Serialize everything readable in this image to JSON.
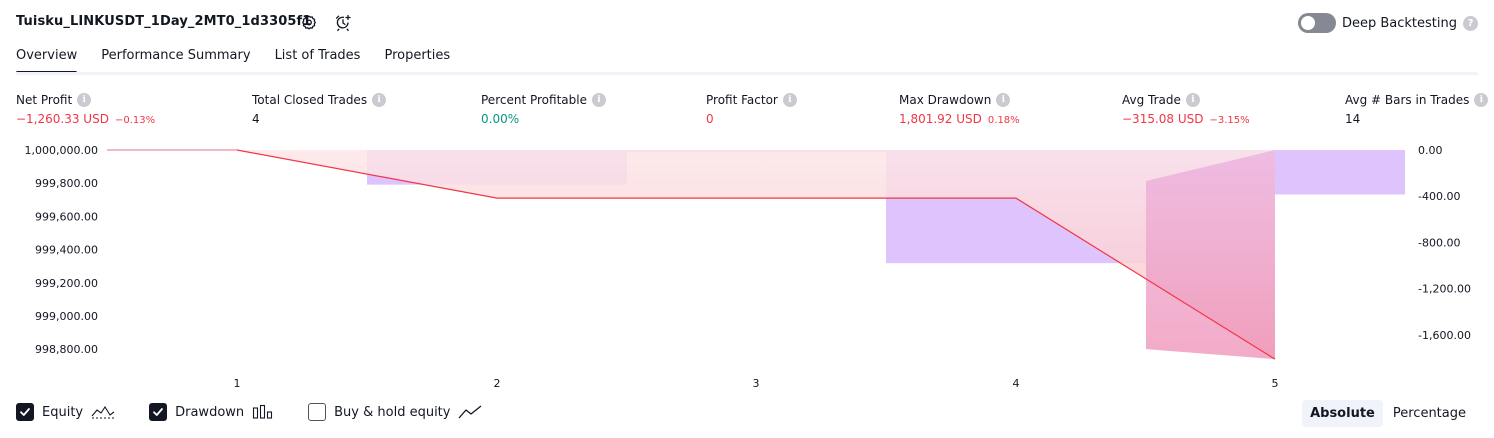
{
  "header": {
    "strategy_title": "Tuisku_LINKUSDT_1Day_2MT0_1d3305f1",
    "settings_icon": "gear-icon",
    "alert_icon": "alarm-clock-plus-icon",
    "deep_backtesting_label": "Deep Backtesting",
    "deep_backtesting_enabled": false,
    "help_icon": "question-icon"
  },
  "tabs": [
    {
      "label": "Overview",
      "active": true
    },
    {
      "label": "Performance Summary",
      "active": false
    },
    {
      "label": "List of Trades",
      "active": false
    },
    {
      "label": "Properties",
      "active": false
    }
  ],
  "metrics": {
    "net_profit": {
      "label": "Net Profit",
      "value": "−1,260.33 USD",
      "sub": "−0.13%"
    },
    "total_closed_trades": {
      "label": "Total Closed Trades",
      "value": "4"
    },
    "percent_profitable": {
      "label": "Percent Profitable",
      "value": "0.00%"
    },
    "profit_factor": {
      "label": "Profit Factor",
      "value": "0"
    },
    "max_drawdown": {
      "label": "Max Drawdown",
      "value": "1,801.92 USD",
      "sub": "0.18%"
    },
    "avg_trade": {
      "label": "Avg Trade",
      "value": "−315.08 USD",
      "sub": "−3.15%"
    },
    "avg_bars": {
      "label": "Avg # Bars in Trades",
      "value": "14"
    }
  },
  "chart_data": {
    "type": "line",
    "x_tick_labels": [
      "1",
      "2",
      "3",
      "4",
      "5"
    ],
    "left_axis": {
      "tick_labels": [
        "1,000,000.00",
        "999,800.00",
        "999,600.00",
        "999,400.00",
        "999,200.00",
        "999,000.00",
        "998,800.00"
      ],
      "ticks": [
        1000000,
        999800,
        999600,
        999400,
        999200,
        999000,
        998800
      ]
    },
    "right_axis": {
      "tick_labels": [
        "0.00",
        "-400.00",
        "-800.00",
        "-1,200.00",
        "-1,600.00"
      ],
      "ticks": [
        0,
        -400,
        -800,
        -1200,
        -1600
      ]
    },
    "equity": {
      "x": [
        0,
        1,
        2,
        3,
        4,
        5
      ],
      "y": [
        1000000,
        1000000,
        999710,
        999710,
        999710,
        998740
      ]
    },
    "drawdown": {
      "bars": [
        {
          "x": 1,
          "value": -300
        },
        {
          "x": 2,
          "value": -20
        },
        {
          "x": 3,
          "value": -980
        },
        {
          "x": 4,
          "value": -385
        },
        {
          "x": 5,
          "value": -1801.92
        }
      ]
    },
    "colors": {
      "equity_line": "#f23645",
      "drawdown_bar": "#dfc3fd",
      "drawdown_gradient_top": "#eab0df",
      "drawdown_gradient_bottom": "#ee8fb5"
    },
    "legend_placement": "bottom-left"
  },
  "legend": [
    {
      "label": "Equity",
      "checked": true,
      "icon": "equity-line-icon"
    },
    {
      "label": "Drawdown",
      "checked": true,
      "icon": "drawdown-bars-icon"
    },
    {
      "label": "Buy & hold equity",
      "checked": false,
      "icon": "buy-hold-line-icon"
    }
  ],
  "scale_toggle": {
    "absolute_label": "Absolute",
    "percentage_label": "Percentage",
    "selected": "Absolute"
  }
}
